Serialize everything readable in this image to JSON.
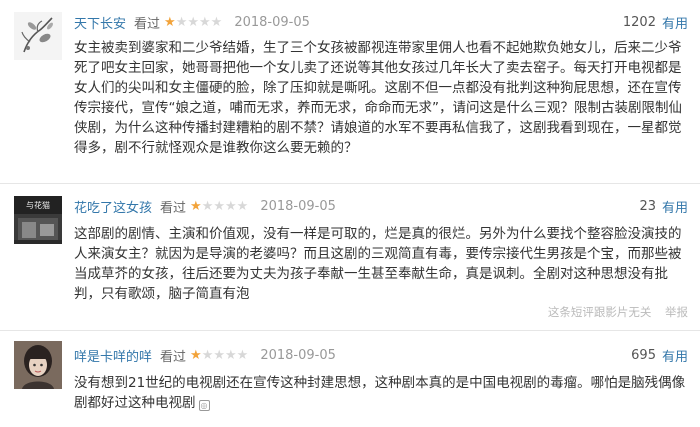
{
  "reviews": [
    {
      "username": "天下长安",
      "watched": "看过",
      "rating": 1,
      "date": "2018-09-05",
      "votes": "1202",
      "useful_label": "有用",
      "text": "女主被卖到婆家和二少爷结婚，生了三个女孩被鄙视连带家里佣人也看不起她欺负她女儿，后来二少爷死了吧女主回家，她哥哥把他一个女儿卖了还说等其他女孩过几年长大了卖去窑子。每天打开电视都是女人们的尖叫和女主僵硬的脸，除了压抑就是嘶吼。这剧不但一点都没有批判这种狗屁思想，还在宣传传宗接代，宣传“娘之道，哺而无求，养而无求，命命而无求”，请问这是什么三观？限制古装剧限制仙侠剧，为什么这种传播封建糟粕的剧不禁？请娘道的水军不要再私信我了，这剧我看到现在，一星都觉得多，剧不行就怪观众是谁教你这么要无赖的？"
    },
    {
      "username": "花吃了这女孩",
      "watched": "看过",
      "rating": 1,
      "date": "2018-09-05",
      "votes": "23",
      "useful_label": "有用",
      "text": "这部剧的剧情、主演和价值观，没有一样是可取的，烂是真的很烂。另外为什么要找个整容脸没演技的人来演女主？就因为是导演的老婆吗？而且这剧的三观简直有毒，要传宗接代生男孩是个宝，而那些被当成草芥的女孩，往后还要为丈夫为孩子奉献一生甚至奉献生命，真是讽刺。全剧对这种思想没有批判，只有歌颂，脑子简直有泡",
      "footer": [
        "这条短评跟影片无关",
        "举报"
      ]
    },
    {
      "username": "咩是卡咩的咩",
      "watched": "看过",
      "rating": 1,
      "date": "2018-09-05",
      "votes": "695",
      "useful_label": "有用",
      "text": "没有想到21世纪的电视剧还在宣传这种封建思想，这种剧本真的是中国电视剧的毒瘤。哪怕是脑残偶像剧都好过这种电视剧"
    }
  ],
  "colors": {
    "link": "#3377aa",
    "star_on": "#f2a33a",
    "star_off": "#d8d8d8"
  }
}
